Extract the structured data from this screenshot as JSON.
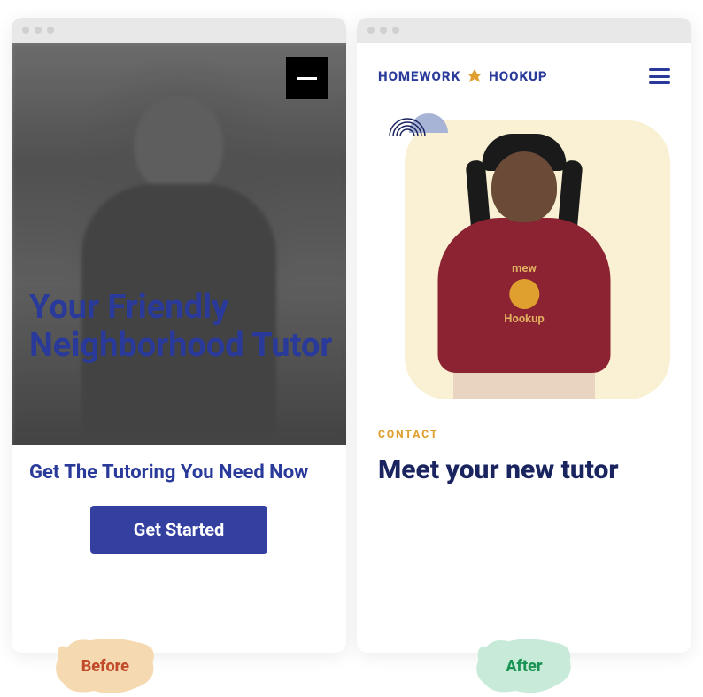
{
  "before": {
    "headline": "Your Friendly Neighborhood Tutor",
    "subhead": "Get The Tutoring You Need Now",
    "cta_label": "Get Started",
    "badge_label": "Before"
  },
  "after": {
    "brand_word1": "HOMEWORK",
    "brand_word2": "HOOKUP",
    "shirt_line1": "mew",
    "shirt_line2": "Hookup",
    "eyebrow": "CONTACT",
    "headline": "Meet your new tutor",
    "badge_label": "After"
  }
}
